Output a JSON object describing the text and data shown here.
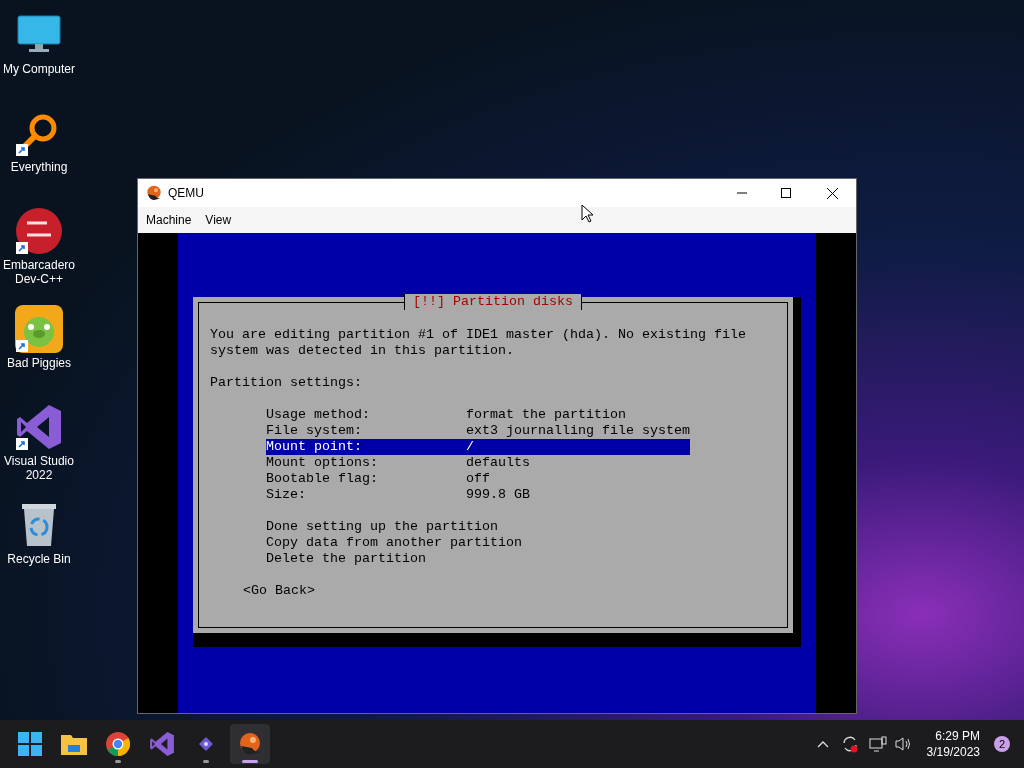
{
  "desktop_icons": [
    {
      "kind": "computer",
      "label": "My Computer",
      "shortcut": false
    },
    {
      "kind": "search",
      "label": "Everything",
      "shortcut": true
    },
    {
      "kind": "devcpp",
      "label": "Embarcadero Dev-C++",
      "shortcut": true
    },
    {
      "kind": "game",
      "label": "Bad Piggies",
      "shortcut": true
    },
    {
      "kind": "vs",
      "label": "Visual Studio 2022",
      "shortcut": true
    },
    {
      "kind": "bin",
      "label": "Recycle Bin",
      "shortcut": false
    }
  ],
  "window": {
    "title": "QEMU",
    "menu": [
      "Machine",
      "View"
    ]
  },
  "installer": {
    "title": "[!!] Partition disks",
    "intro": "You are editing partition #1 of IDE1 master (hda). No existing file system was detected in this partition.",
    "section_label": "Partition settings:",
    "settings": [
      {
        "label": "Usage method:",
        "value": "format the partition",
        "selected": false
      },
      {
        "label": "File system:",
        "value": "ext3 journalling file system",
        "selected": false
      },
      {
        "label": "Mount point:",
        "value": "/",
        "selected": true
      },
      {
        "label": "Mount options:",
        "value": "defaults",
        "selected": false
      },
      {
        "label": "Bootable flag:",
        "value": "off",
        "selected": false
      },
      {
        "label": "Size:",
        "value": "999.8 GB",
        "selected": false
      }
    ],
    "actions": [
      "Done setting up the partition",
      "Copy data from another partition",
      "Delete the partition"
    ],
    "back_button": "<Go Back>"
  },
  "taskbar": {
    "apps": [
      {
        "kind": "start",
        "running": false,
        "active": false
      },
      {
        "kind": "folder",
        "running": false,
        "active": false
      },
      {
        "kind": "browser",
        "running": true,
        "active": false
      },
      {
        "kind": "vs",
        "running": false,
        "active": false
      },
      {
        "kind": "small",
        "running": true,
        "active": false
      },
      {
        "kind": "qemu",
        "running": true,
        "active": true
      }
    ],
    "time": "6:29 PM",
    "date": "3/19/2023",
    "notification_count": "2"
  }
}
